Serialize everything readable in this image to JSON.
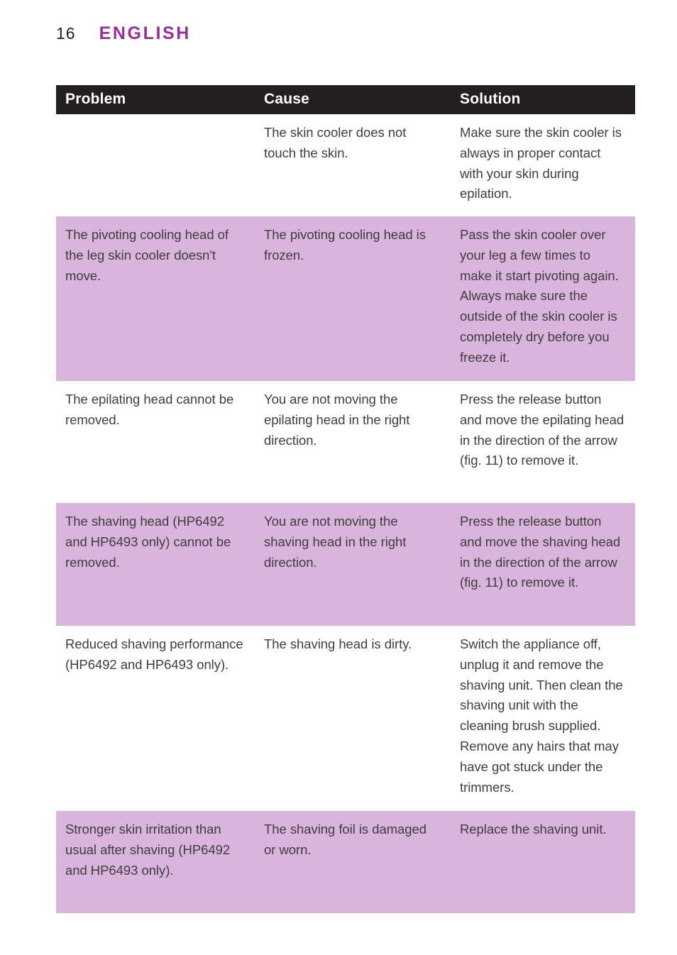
{
  "header": {
    "page_number": "16",
    "section": "ENGLISH"
  },
  "colors": {
    "accent_purple": "#9c2d9c",
    "row_tint": "#d9b4dc",
    "header_bar": "#231f20",
    "body_text": "#403d3e"
  },
  "table": {
    "columns": [
      {
        "key": "problem",
        "label": "Problem"
      },
      {
        "key": "cause",
        "label": "Cause"
      },
      {
        "key": "solution",
        "label": "Solution"
      }
    ],
    "rows": [
      {
        "tint": false,
        "problem": "",
        "cause": "The skin cooler does not touch the skin.",
        "solution": "Make sure the skin cooler is always in proper contact with your skin during epilation."
      },
      {
        "tint": true,
        "problem": "The pivoting cooling head of the leg skin cooler doesn't move.",
        "cause": "The pivoting cooling head is frozen.",
        "solution": "Pass the skin cooler over your leg a few times to make it start pivoting again. Always make sure the outside of the skin cooler is completely dry before you freeze it."
      },
      {
        "tint": false,
        "problem": "The epilating head cannot be removed.",
        "cause": "You are not moving the epilating head in the right direction.",
        "solution": "Press the release button and move the epilating head in the direction of the arrow (fig. 11) to remove it."
      },
      {
        "tint": true,
        "problem": "The shaving head (HP6492 and HP6493 only) cannot be removed.",
        "cause": "You are not moving the shaving head in the right direction.",
        "solution": "Press the release button and move the shaving head in the direction of the arrow (fig. 11) to remove it."
      },
      {
        "tint": false,
        "problem": "Reduced shaving performance (HP6492 and HP6493 only).",
        "cause": "The shaving head is dirty.",
        "solution": "Switch the appliance off, unplug it and remove the shaving unit. Then clean the shaving unit with the cleaning brush supplied. Remove any hairs that may have got stuck under the trimmers."
      },
      {
        "tint": true,
        "problem": "Stronger skin irritation than usual after shaving (HP6492 and HP6493 only).",
        "cause": "The shaving foil is damaged or worn.",
        "solution": "Replace the shaving unit."
      }
    ]
  }
}
